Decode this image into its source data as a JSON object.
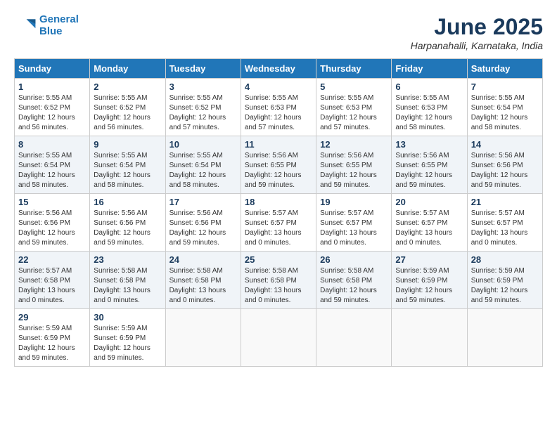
{
  "logo": {
    "line1": "General",
    "line2": "Blue"
  },
  "title": "June 2025",
  "subtitle": "Harpanahalli, Karnataka, India",
  "weekdays": [
    "Sunday",
    "Monday",
    "Tuesday",
    "Wednesday",
    "Thursday",
    "Friday",
    "Saturday"
  ],
  "weeks": [
    [
      {
        "day": 1,
        "info": "Sunrise: 5:55 AM\nSunset: 6:52 PM\nDaylight: 12 hours\nand 56 minutes."
      },
      {
        "day": 2,
        "info": "Sunrise: 5:55 AM\nSunset: 6:52 PM\nDaylight: 12 hours\nand 56 minutes."
      },
      {
        "day": 3,
        "info": "Sunrise: 5:55 AM\nSunset: 6:52 PM\nDaylight: 12 hours\nand 57 minutes."
      },
      {
        "day": 4,
        "info": "Sunrise: 5:55 AM\nSunset: 6:53 PM\nDaylight: 12 hours\nand 57 minutes."
      },
      {
        "day": 5,
        "info": "Sunrise: 5:55 AM\nSunset: 6:53 PM\nDaylight: 12 hours\nand 57 minutes."
      },
      {
        "day": 6,
        "info": "Sunrise: 5:55 AM\nSunset: 6:53 PM\nDaylight: 12 hours\nand 58 minutes."
      },
      {
        "day": 7,
        "info": "Sunrise: 5:55 AM\nSunset: 6:54 PM\nDaylight: 12 hours\nand 58 minutes."
      }
    ],
    [
      {
        "day": 8,
        "info": "Sunrise: 5:55 AM\nSunset: 6:54 PM\nDaylight: 12 hours\nand 58 minutes."
      },
      {
        "day": 9,
        "info": "Sunrise: 5:55 AM\nSunset: 6:54 PM\nDaylight: 12 hours\nand 58 minutes."
      },
      {
        "day": 10,
        "info": "Sunrise: 5:55 AM\nSunset: 6:54 PM\nDaylight: 12 hours\nand 58 minutes."
      },
      {
        "day": 11,
        "info": "Sunrise: 5:56 AM\nSunset: 6:55 PM\nDaylight: 12 hours\nand 59 minutes."
      },
      {
        "day": 12,
        "info": "Sunrise: 5:56 AM\nSunset: 6:55 PM\nDaylight: 12 hours\nand 59 minutes."
      },
      {
        "day": 13,
        "info": "Sunrise: 5:56 AM\nSunset: 6:55 PM\nDaylight: 12 hours\nand 59 minutes."
      },
      {
        "day": 14,
        "info": "Sunrise: 5:56 AM\nSunset: 6:56 PM\nDaylight: 12 hours\nand 59 minutes."
      }
    ],
    [
      {
        "day": 15,
        "info": "Sunrise: 5:56 AM\nSunset: 6:56 PM\nDaylight: 12 hours\nand 59 minutes."
      },
      {
        "day": 16,
        "info": "Sunrise: 5:56 AM\nSunset: 6:56 PM\nDaylight: 12 hours\nand 59 minutes."
      },
      {
        "day": 17,
        "info": "Sunrise: 5:56 AM\nSunset: 6:56 PM\nDaylight: 12 hours\nand 59 minutes."
      },
      {
        "day": 18,
        "info": "Sunrise: 5:57 AM\nSunset: 6:57 PM\nDaylight: 13 hours\nand 0 minutes."
      },
      {
        "day": 19,
        "info": "Sunrise: 5:57 AM\nSunset: 6:57 PM\nDaylight: 13 hours\nand 0 minutes."
      },
      {
        "day": 20,
        "info": "Sunrise: 5:57 AM\nSunset: 6:57 PM\nDaylight: 13 hours\nand 0 minutes."
      },
      {
        "day": 21,
        "info": "Sunrise: 5:57 AM\nSunset: 6:57 PM\nDaylight: 13 hours\nand 0 minutes."
      }
    ],
    [
      {
        "day": 22,
        "info": "Sunrise: 5:57 AM\nSunset: 6:58 PM\nDaylight: 13 hours\nand 0 minutes."
      },
      {
        "day": 23,
        "info": "Sunrise: 5:58 AM\nSunset: 6:58 PM\nDaylight: 13 hours\nand 0 minutes."
      },
      {
        "day": 24,
        "info": "Sunrise: 5:58 AM\nSunset: 6:58 PM\nDaylight: 13 hours\nand 0 minutes."
      },
      {
        "day": 25,
        "info": "Sunrise: 5:58 AM\nSunset: 6:58 PM\nDaylight: 13 hours\nand 0 minutes."
      },
      {
        "day": 26,
        "info": "Sunrise: 5:58 AM\nSunset: 6:58 PM\nDaylight: 12 hours\nand 59 minutes."
      },
      {
        "day": 27,
        "info": "Sunrise: 5:59 AM\nSunset: 6:59 PM\nDaylight: 12 hours\nand 59 minutes."
      },
      {
        "day": 28,
        "info": "Sunrise: 5:59 AM\nSunset: 6:59 PM\nDaylight: 12 hours\nand 59 minutes."
      }
    ],
    [
      {
        "day": 29,
        "info": "Sunrise: 5:59 AM\nSunset: 6:59 PM\nDaylight: 12 hours\nand 59 minutes."
      },
      {
        "day": 30,
        "info": "Sunrise: 5:59 AM\nSunset: 6:59 PM\nDaylight: 12 hours\nand 59 minutes."
      },
      null,
      null,
      null,
      null,
      null
    ]
  ]
}
